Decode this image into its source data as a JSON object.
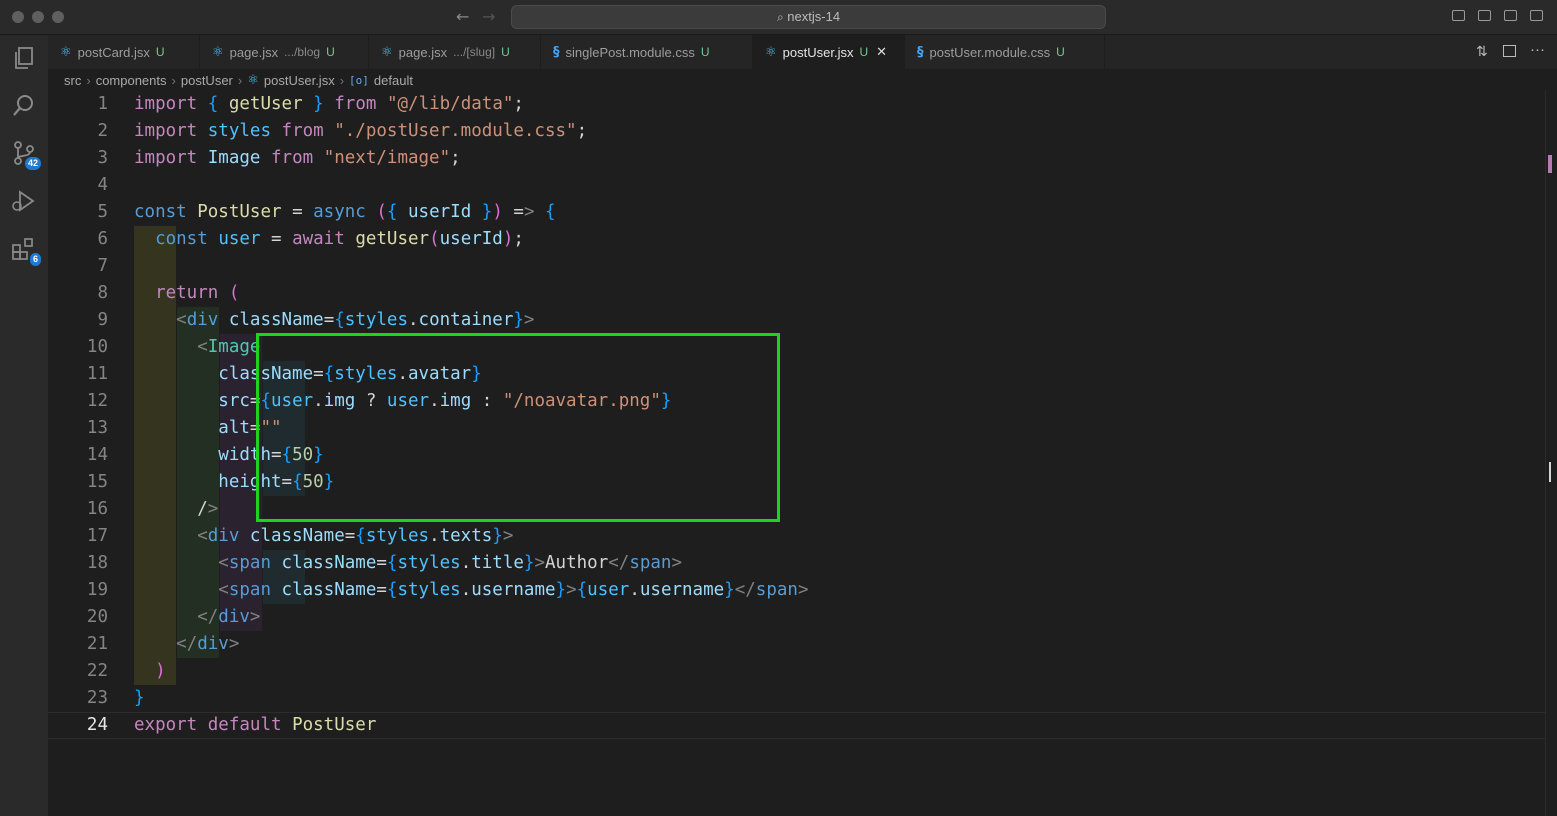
{
  "window": {
    "title": "nextjs-14",
    "search_icon": "search-icon"
  },
  "activity": {
    "scm_badge": "42",
    "extensions_badge": "6"
  },
  "tabs": [
    {
      "label": "postCard.jsx",
      "path": "",
      "status": "U",
      "kind": "react"
    },
    {
      "label": "page.jsx",
      "path": ".../blog",
      "status": "U",
      "kind": "react"
    },
    {
      "label": "page.jsx",
      "path": ".../[slug]",
      "status": "U",
      "kind": "react"
    },
    {
      "label": "singlePost.module.css",
      "path": "",
      "status": "U",
      "kind": "css"
    },
    {
      "label": "postUser.jsx",
      "path": "",
      "status": "U",
      "kind": "react",
      "active": true
    },
    {
      "label": "postUser.module.css",
      "path": "",
      "status": "U",
      "kind": "css"
    }
  ],
  "breadcrumb": [
    "src",
    "components",
    "postUser",
    "postUser.jsx",
    "default"
  ],
  "editor": {
    "current_line": 24,
    "lines": [
      "import { getUser } from \"@/lib/data\";",
      "import styles from \"./postUser.module.css\";",
      "import Image from \"next/image\";",
      "",
      "const PostUser = async ({ userId }) => {",
      "  const user = await getUser(userId);",
      "",
      "  return (",
      "    <div className={styles.container}>",
      "      <Image",
      "        className={styles.avatar}",
      "        src={user.img ? user.img : \"/noavatar.png\"}",
      "        alt=\"\"",
      "        width={50}",
      "        height={50}",
      "      />",
      "      <div className={styles.texts}>",
      "        <span className={styles.title}>Author</span>",
      "        <span className={styles.username}>{user.username}</span>",
      "      </div>",
      "    </div>",
      "  )",
      "}",
      "export default PostUser"
    ]
  },
  "colors": {
    "highlight_box": "#1ed31e",
    "accent": "#1f7ad1"
  }
}
